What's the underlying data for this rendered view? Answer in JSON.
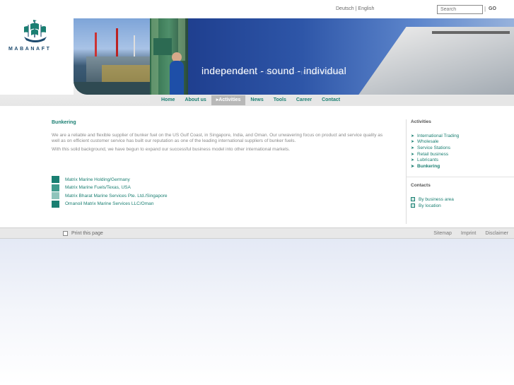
{
  "header": {
    "lang_de": "Deutsch",
    "lang_sep": "|",
    "lang_en": "English",
    "search_placeholder": "Search",
    "go_label": "GO",
    "logo_text": "MABANAFT",
    "tagline": "independent - sound - individual"
  },
  "nav": {
    "items": [
      "Home",
      "About us",
      "Activities",
      "News",
      "Tools",
      "Career",
      "Contact"
    ],
    "active": "Activities"
  },
  "main": {
    "title": "Bunkering",
    "paragraphs": [
      "We are a reliable and flexible supplier of bunker fuel on the US Gulf Coast, in Singapore, India, and Oman. Our unwavering focus on product and service quality as well as on efficient customer service has built our reputation as one of the leading international suppliers of bunker fuels.",
      "With this solid background, we have begun to expand our successful business model into other international markets."
    ],
    "companies": [
      {
        "label": "Matrix Marine Holding/Germany",
        "color": "#1a7f72"
      },
      {
        "label": "Matrix Marine Fuels/Texas, USA",
        "color": "#3f9a8c"
      },
      {
        "label": "Matrix Bharat Marine Services Pte. Ltd./Singapore",
        "color": "#8fc4bb"
      },
      {
        "label": "Omanoil Matrix Marine Services LLC/Oman",
        "color": "#1a7f72"
      }
    ]
  },
  "sidebar": {
    "activities_title": "Activities",
    "activities": [
      "International Trading",
      "Wholesale",
      "Service Stations",
      "Retail business",
      "Lubricants",
      "Bunkering"
    ],
    "current": "Bunkering",
    "contacts_title": "Contacts",
    "contacts": [
      "By business area",
      "By location"
    ]
  },
  "footer": {
    "print": "Print this page",
    "links": [
      "Sitemap",
      "Imprint",
      "Disclaimer"
    ]
  },
  "colors": {
    "accent": "#1a7f72",
    "nav_bg": "#e6e6e6",
    "banner": "#2e56a8"
  }
}
